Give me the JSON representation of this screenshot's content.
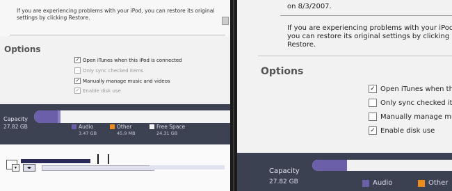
{
  "left": {
    "description_text": "If you are experiencing problems with your iPod, you can restore its original settings by clicking Restore.",
    "options_title": "Options",
    "options": [
      {
        "label": "Open iTunes when this iPod is connected",
        "checked": true,
        "enabled": true
      },
      {
        "label": "Only sync checked items",
        "checked": false,
        "enabled": false
      },
      {
        "label": "Manually manage music and videos",
        "checked": true,
        "enabled": true
      },
      {
        "label": "Enable disk use",
        "checked": true,
        "enabled": false
      }
    ],
    "capacity": {
      "label": "Capacity",
      "value": "27.82 GB",
      "legend": [
        {
          "name": "Audio",
          "size": "3.47 GB",
          "color": "#6a5fa8"
        },
        {
          "name": "Other",
          "size": "45.9 MB",
          "color": "#f08c1e"
        },
        {
          "name": "Free Space",
          "size": "24.31 GB",
          "color": "#f3f3f3"
        }
      ]
    }
  },
  "right": {
    "date_text": "on 8/3/2007.",
    "description_text": "If you are experiencing problems with your iPod, you can restore its original settings by clicking Restore.",
    "options_title": "Options",
    "options": [
      {
        "label": "Open iTunes when this iPod is connected",
        "checked": true
      },
      {
        "label": "Only sync checked items",
        "checked": false
      },
      {
        "label": "Manually manage music and videos",
        "checked": false
      },
      {
        "label": "Enable disk use",
        "checked": true
      }
    ],
    "capacity": {
      "label": "Capacity",
      "value": "27.82 GB",
      "legend": [
        {
          "name": "Audio",
          "color": "#6a5fa8"
        },
        {
          "name": "Other",
          "color": "#f08c1e"
        }
      ]
    }
  },
  "check_mark": "✓"
}
